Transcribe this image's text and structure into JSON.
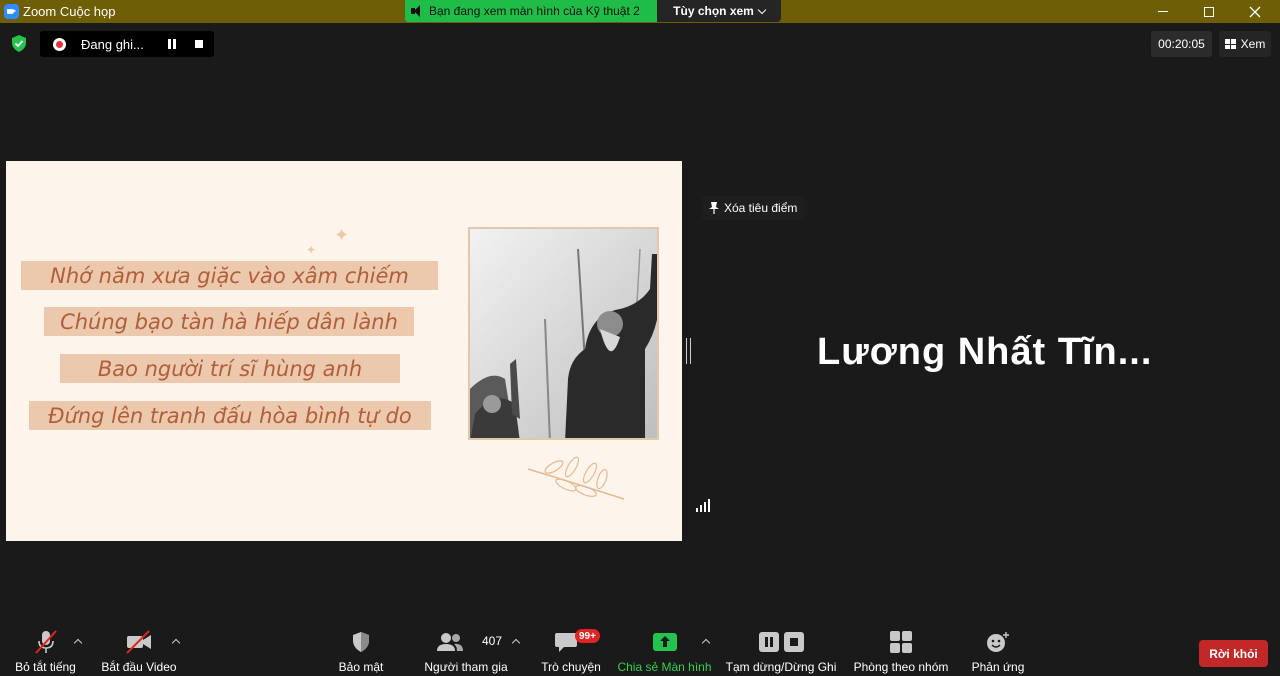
{
  "window": {
    "title": "Zoom Cuộc họp",
    "share_banner": "Bạn đang xem màn hình của Kỹ thuật 2",
    "view_options": "Tùy chọn xem"
  },
  "recording": {
    "status": "Đang ghi..."
  },
  "meeting": {
    "timer": "00:20:05",
    "view_label": "Xem"
  },
  "slide": {
    "poem_lines": [
      "Nhớ năm xưa giặc vào xâm chiếm",
      "Chúng bạo tàn hà hiếp dân lành",
      "Bao người trí sĩ hùng anh",
      "Đứng lên tranh đấu hòa bình tự do"
    ]
  },
  "spotlight": {
    "remove_label": "Xóa tiêu điểm",
    "participant_name": "Lương Nhất Tĩn..."
  },
  "toolbar": {
    "mute": "Bỏ tắt tiếng",
    "video": "Bắt đầu Video",
    "security": "Bảo mật",
    "participants": "Người tham gia",
    "participants_count": "407",
    "chat": "Trò chuyện",
    "chat_badge": "99+",
    "share": "Chia sẻ Màn hình",
    "record": "Tạm dừng/Dừng Ghi",
    "breakout": "Phòng theo nhóm",
    "reactions": "Phản ứng",
    "leave": "Rời khỏi"
  },
  "colors": {
    "title_bar": "#6e5e06",
    "share_banner": "#1fbd48",
    "leave_button": "#c32828",
    "share_label": "#2fd24f",
    "poem_text": "#b05e3c",
    "poem_band": "#ecc9ad"
  }
}
